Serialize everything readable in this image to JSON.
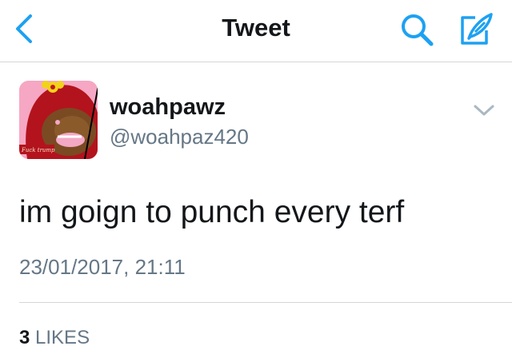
{
  "nav": {
    "title": "Tweet",
    "accent": "#1da1f2"
  },
  "tweet": {
    "display_name": "woahpawz",
    "handle": "@woahpaz420",
    "avatar_caption": "Fuck trump",
    "text": "im goign to punch every terf",
    "timestamp": "23/01/2017, 21:11",
    "likes_count": "3",
    "likes_label": "LIKES"
  },
  "icons": {
    "back": "chevron-left-icon",
    "search": "search-icon",
    "compose": "compose-feather-icon",
    "more": "chevron-down-icon"
  }
}
